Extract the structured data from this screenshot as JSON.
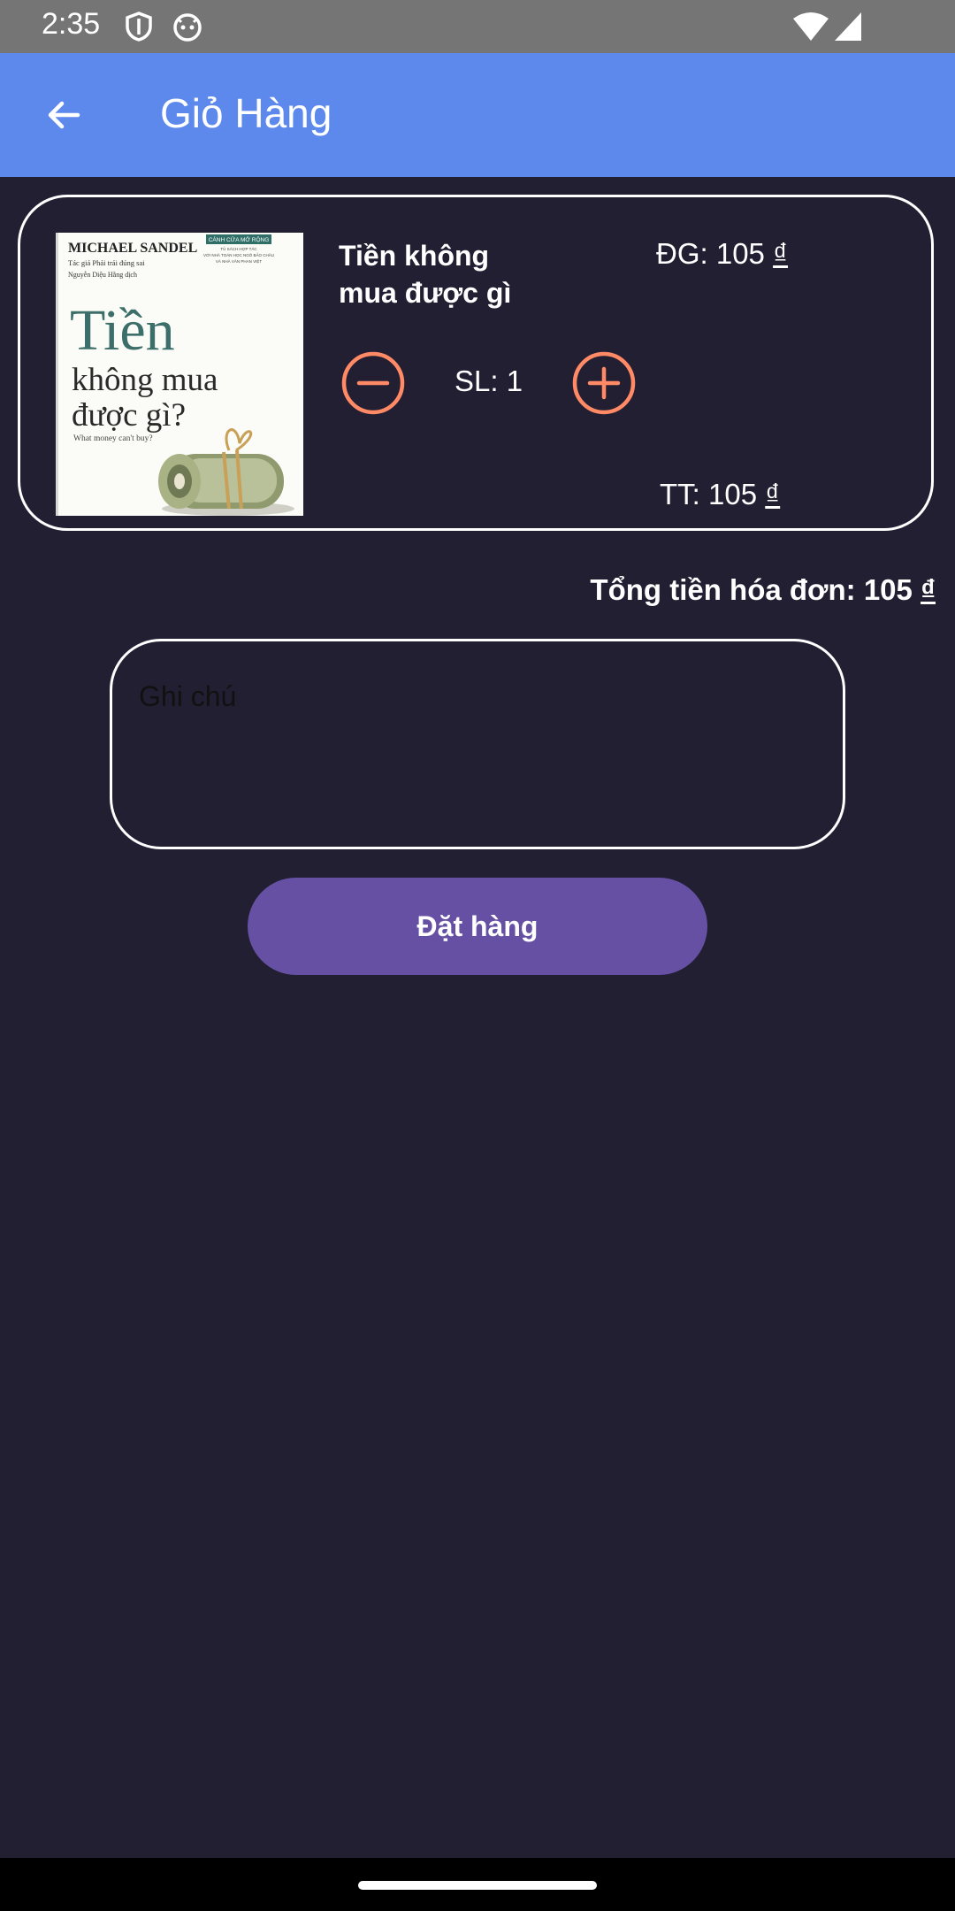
{
  "status_bar": {
    "time": "2:35",
    "icons": [
      "shield-icon",
      "android-face-icon",
      "wifi-icon",
      "cellular-signal-icon"
    ]
  },
  "app_bar": {
    "back_icon": "arrow-back-icon",
    "title": "Giỏ Hàng",
    "color": "#5e89ec"
  },
  "cart": {
    "items": [
      {
        "cover": {
          "author": "MICHAEL SANDEL",
          "by_line": "Tác giả Phải trái đúng sai",
          "translator": "Nguyễn Diệu Hằng dịch",
          "badge": "CÁNH CỬA MỞ RỘNG",
          "badge_note_1": "TỦ SÁCH HỢP TÁC",
          "badge_note_2": "VỚI NHÀ TOÁN HỌC NGÔ BẢO CHÂU",
          "badge_note_3": "VÀ NHÀ VĂN PHAN VIỆT",
          "title_line_1": "Tiền",
          "title_line_2": "không mua",
          "title_line_3": "được gì?",
          "subtitle": "What money can't buy?"
        },
        "name": "Tiền không mua được gì",
        "unit_price_label": "ĐG: 105",
        "quantity_label": "SL: 1",
        "line_total_label": "TT: 105",
        "currency": "₫",
        "minus_icon": "minus-circle-icon",
        "plus_icon": "plus-circle-icon"
      }
    ]
  },
  "invoice_total_label": "Tổng tiền hóa đơn: 105",
  "invoice_currency": "₫",
  "note": {
    "placeholder": "Ghi chú",
    "value": ""
  },
  "order_button": {
    "label": "Đặt hàng",
    "color": "#6650a4"
  },
  "colors": {
    "background": "#221f33",
    "accent_icon": "#ff8a65"
  }
}
